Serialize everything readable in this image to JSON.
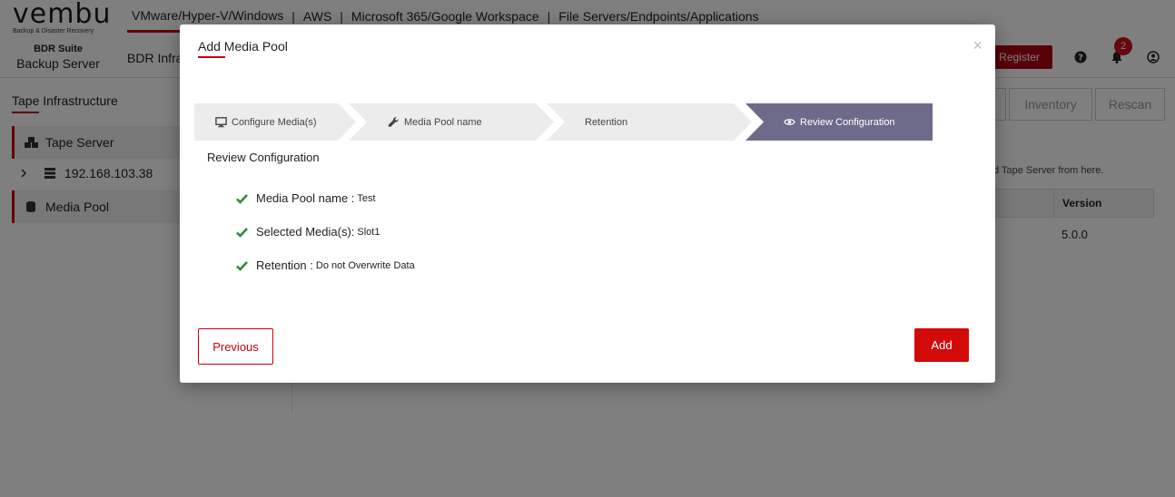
{
  "app": {
    "logo_text": "vembu",
    "logo_tagline": "Backup & Disaster Recovery",
    "product_name": "BDR Suite",
    "product_sub": "Backup Server"
  },
  "topnav": {
    "items": [
      "VMware/Hyper-V/Windows",
      "AWS",
      "Microsoft 365/Google Workspace",
      "File Servers/Endpoints/Applications"
    ],
    "separator": "|"
  },
  "subnav": {
    "label": "BDR Infra"
  },
  "header": {
    "register_label": "Register",
    "notification_count": "2",
    "icons": [
      "help-icon",
      "bell-icon",
      "user-icon"
    ]
  },
  "sidebar": {
    "title": "Tape Infrastructure",
    "tape_server": {
      "label": "Tape Server",
      "icon": "cubes-icon"
    },
    "server_ip": "192.168.103.38",
    "media_pool": {
      "label": "Media Pool",
      "icon": "database-icon"
    }
  },
  "main": {
    "inventory_label": "Inventory",
    "rescan_label": "Rescan",
    "info_text": "d Tape Server from here.",
    "table": {
      "version_header": "Version",
      "version_value": "5.0.0"
    }
  },
  "modal": {
    "title": "Add Media Pool",
    "close_symbol": "×",
    "steps": [
      {
        "label": "Configure Media(s)",
        "icon": "monitor-icon",
        "active": false
      },
      {
        "label": "Media Pool name",
        "icon": "wrench-icon",
        "active": false
      },
      {
        "label": "Retention",
        "icon": "",
        "active": false
      },
      {
        "label": "Review Configuration",
        "icon": "eye-icon",
        "active": true
      }
    ],
    "review_heading": "Review Configuration",
    "review_items": [
      {
        "label": "Media Pool name :",
        "value": "Test"
      },
      {
        "label": "Selected Media(s):",
        "value": "Slot1"
      },
      {
        "label": "Retention :",
        "value": "Do not Overwrite Data"
      }
    ],
    "previous_label": "Previous",
    "add_label": "Add"
  },
  "colors": {
    "accent": "#c8000a",
    "active_step": "#6e6a8a",
    "inactive_step": "#ececec",
    "check": "#2e8b3a"
  }
}
